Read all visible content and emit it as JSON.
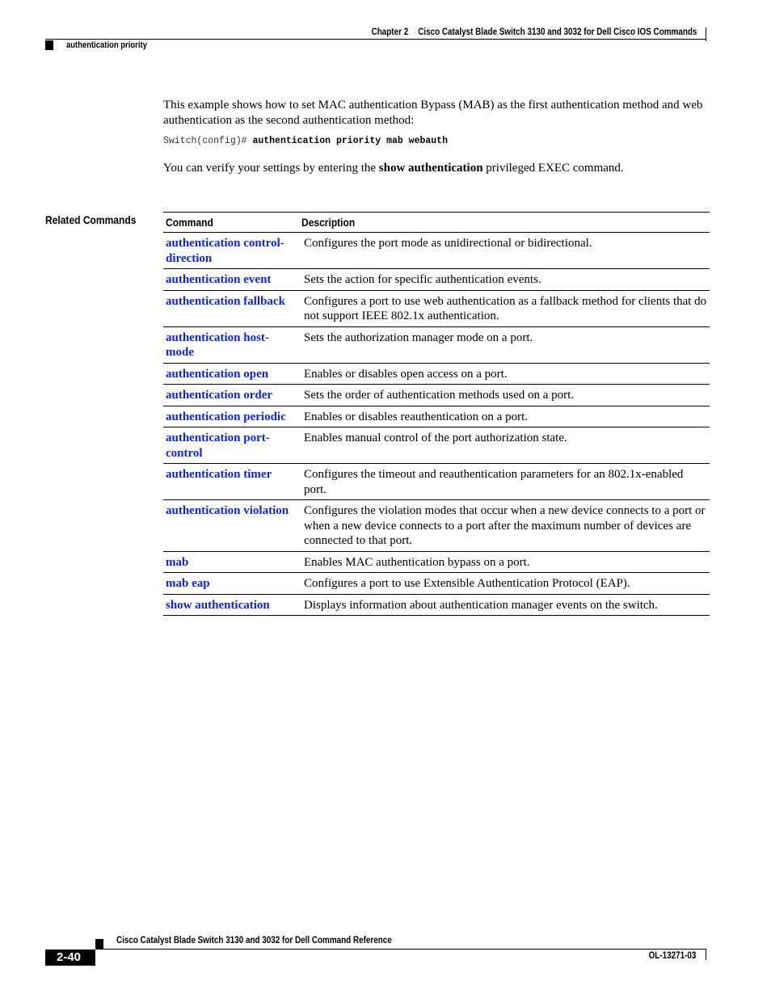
{
  "header": {
    "chapter_label": "Chapter 2",
    "chapter_title": "Cisco Catalyst Blade Switch 3130 and 3032 for Dell Cisco IOS Commands",
    "section": "authentication priority"
  },
  "body": {
    "intro_paragraph": "This example shows how to set MAC authentication Bypass (MAB) as the first authentication method and web authentication as the second authentication method:",
    "cli_prompt": "Switch(config)#",
    "cli_command": "authentication priority mab webauth",
    "verify_prefix": "You can verify your settings by entering the ",
    "verify_command": "show authentication",
    "verify_suffix": " privileged EXEC command."
  },
  "related_commands": {
    "label": "Related Commands",
    "columns": [
      "Command",
      "Description"
    ],
    "rows": [
      {
        "command": "authentication control-direction",
        "description": "Configures the port mode as unidirectional or bidirectional."
      },
      {
        "command": "authentication event",
        "description": "Sets the action for specific authentication events."
      },
      {
        "command": "authentication fallback",
        "description": "Configures a port to use web authentication as a fallback method for clients that do not support IEEE 802.1x authentication."
      },
      {
        "command": "authentication host-mode",
        "description": "Sets the authorization manager mode on a port."
      },
      {
        "command": "authentication open",
        "description": "Enables or disables open access on a port."
      },
      {
        "command": "authentication order",
        "description": "Sets the order of authentication methods used on a port."
      },
      {
        "command": "authentication periodic",
        "description": "Enables or disables reauthentication on a port."
      },
      {
        "command": "authentication port-control",
        "description": "Enables manual control of the port authorization state."
      },
      {
        "command": "authentication timer",
        "description": "Configures the timeout and reauthentication parameters for an 802.1x-enabled port."
      },
      {
        "command": "authentication violation",
        "description": "Configures the violation modes that occur when a new device connects to a port or when a new device connects to a port after the maximum number of devices are connected to that port."
      },
      {
        "command": "mab",
        "description": "Enables MAC authentication bypass on a port."
      },
      {
        "command": "mab eap",
        "description": "Configures a port to use Extensible Authentication Protocol (EAP)."
      },
      {
        "command": "show authentication",
        "description": "Displays information about authentication manager events on the switch."
      }
    ]
  },
  "footer": {
    "book_title": "Cisco Catalyst Blade Switch 3130 and 3032 for Dell Command Reference",
    "page_number": "2-40",
    "doc_number": "OL-13271-03"
  },
  "colors": {
    "link": "#0b24e6",
    "text": "#000000"
  }
}
